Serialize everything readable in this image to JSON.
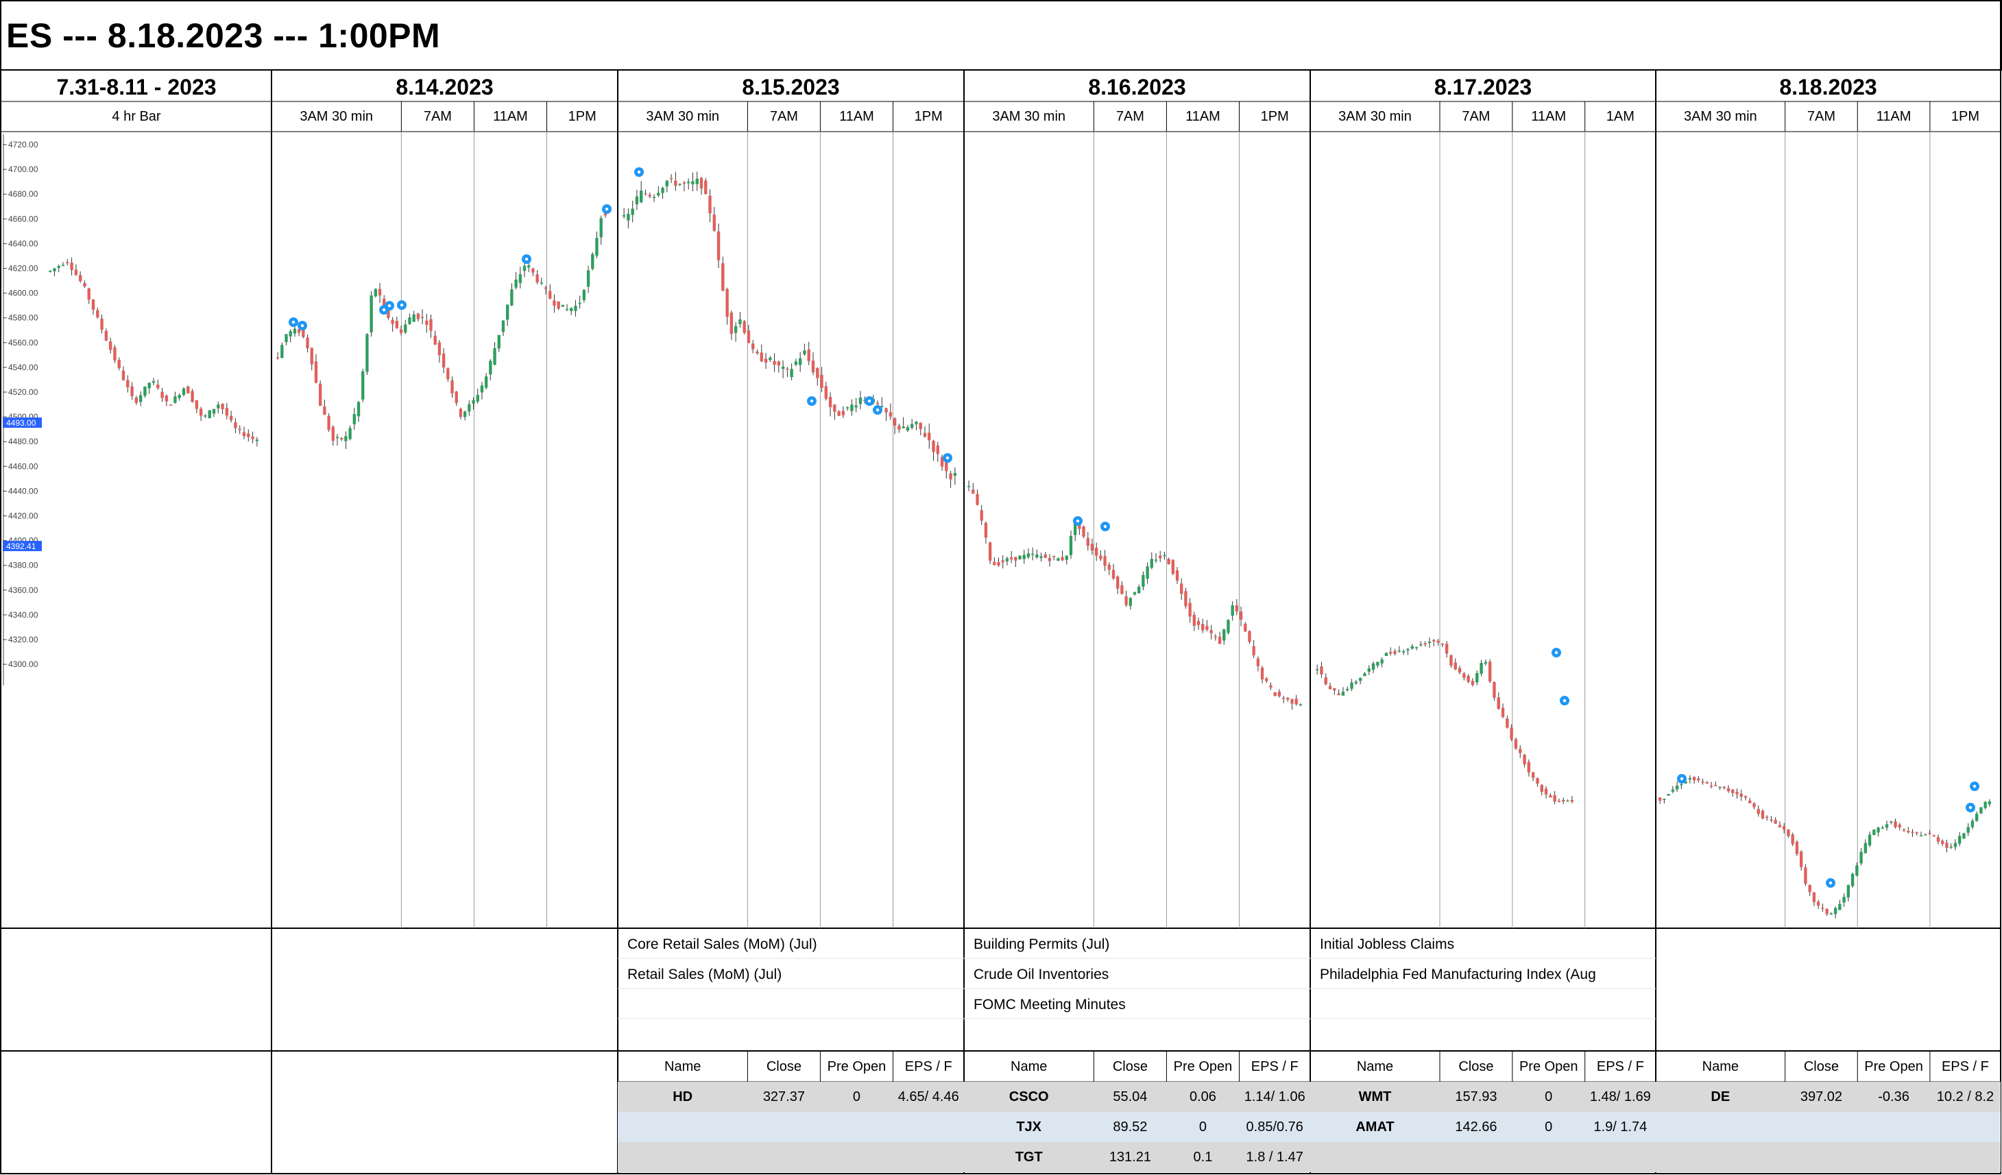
{
  "title": "ES --- 8.18.2023 --- 1:00PM",
  "colors": {
    "up": "#2e9e5e",
    "down": "#e0605c",
    "grid": "#9a9a9a",
    "badge": "#2196f3",
    "row_gray": "#d9d9d9",
    "row_blue": "#dce6f1",
    "price_tag": "#2962ff"
  },
  "days": [
    {
      "label": "7.31-8.11 - 2023",
      "sessions": [
        "4 hr Bar"
      ]
    },
    {
      "label": "8.14.2023",
      "sessions": [
        "3AM 30 min",
        "7AM",
        "11AM",
        "1PM"
      ]
    },
    {
      "label": "8.15.2023",
      "sessions": [
        "3AM 30 min",
        "7AM",
        "11AM",
        "1PM"
      ]
    },
    {
      "label": "8.16.2023",
      "sessions": [
        "3AM 30 min",
        "7AM",
        "11AM",
        "1PM"
      ]
    },
    {
      "label": "8.17.2023",
      "sessions": [
        "3AM 30 min",
        "7AM",
        "11AM",
        "1AM"
      ]
    },
    {
      "label": "8.18.2023",
      "sessions": [
        "3AM 30 min",
        "7AM",
        "11AM",
        "1PM"
      ]
    }
  ],
  "events": [
    {
      "day": 2,
      "items": [
        "Core Retail Sales (MoM) (Jul)",
        "Retail Sales (MoM) (Jul)"
      ]
    },
    {
      "day": 3,
      "items": [
        "Building Permits (Jul)",
        "Crude Oil Inventories",
        "FOMC Meeting Minutes"
      ]
    },
    {
      "day": 4,
      "items": [
        "Initial Jobless Claims",
        "Philadelphia Fed Manufacturing Index (Aug"
      ]
    }
  ],
  "earnings": {
    "headers": [
      "Name",
      "Close",
      "Pre Open",
      "EPS / F"
    ],
    "tables": [
      {
        "day": 2,
        "rows": [
          [
            "HD",
            "327.37",
            "0",
            "4.65/ 4.46"
          ]
        ]
      },
      {
        "day": 3,
        "rows": [
          [
            "CSCO",
            "55.04",
            "0.06",
            "1.14/ 1.06"
          ],
          [
            "TJX",
            "89.52",
            "0",
            "0.85/0.76"
          ],
          [
            "TGT",
            "131.21",
            "0.1",
            "1.8 / 1.47"
          ]
        ]
      },
      {
        "day": 4,
        "rows": [
          [
            "WMT",
            "157.93",
            "0",
            "1.48/ 1.69"
          ],
          [
            "AMAT",
            "142.66",
            "0",
            "1.9/ 1.74"
          ]
        ]
      },
      {
        "day": 5,
        "rows": [
          [
            "DE",
            "397.02",
            "-0.36",
            "10.2 / 8.2"
          ]
        ]
      }
    ]
  },
  "chart_data": {
    "type": "candlestick",
    "symbol": "ES",
    "y_axis": {
      "ticks": [
        4720,
        4700,
        4680,
        4660,
        4640,
        4620,
        4600,
        4580,
        4560,
        4540,
        4520,
        4500,
        4480,
        4460,
        4440,
        4420,
        4400,
        4380,
        4360,
        4340,
        4320,
        4300
      ],
      "tick_labels": [
        "4720.00",
        "4700.00",
        "4680.00",
        "4660.00",
        "4640.00",
        "4620.00",
        "4600.00",
        "4580.00",
        "4560.00",
        "4540.00",
        "4520.00",
        "4500.00",
        "4480.00",
        "4460.00",
        "4440.00",
        "4420.00",
        "4400.00",
        "4380.00",
        "4360.00",
        "4340.00",
        "4320.00",
        "4300.00"
      ],
      "price_tags": [
        "4493.00",
        "4392.41"
      ]
    },
    "panels": [
      {
        "id": "7.31-8.11",
        "y_range": [
          4300,
          4720
        ],
        "paths": [
          [
            0.02,
            4612
          ],
          [
            0.1,
            4620
          ],
          [
            0.18,
            4600
          ],
          [
            0.26,
            4570
          ],
          [
            0.34,
            4540
          ],
          [
            0.42,
            4512
          ],
          [
            0.5,
            4530
          ],
          [
            0.58,
            4510
          ],
          [
            0.66,
            4525
          ],
          [
            0.74,
            4500
          ],
          [
            0.82,
            4512
          ],
          [
            0.9,
            4492
          ],
          [
            0.98,
            4485
          ]
        ]
      },
      {
        "id": "8.14",
        "y_range": [
          4300,
          4720
        ],
        "paths": [
          [
            0.01,
            4540
          ],
          [
            0.04,
            4560
          ],
          [
            0.08,
            4562
          ],
          [
            0.11,
            4545
          ],
          [
            0.14,
            4505
          ],
          [
            0.18,
            4475
          ],
          [
            0.22,
            4478
          ],
          [
            0.26,
            4508
          ],
          [
            0.3,
            4600
          ],
          [
            0.34,
            4575
          ],
          [
            0.38,
            4560
          ],
          [
            0.42,
            4575
          ],
          [
            0.46,
            4570
          ],
          [
            0.52,
            4530
          ],
          [
            0.56,
            4495
          ],
          [
            0.6,
            4505
          ],
          [
            0.64,
            4525
          ],
          [
            0.68,
            4560
          ],
          [
            0.72,
            4595
          ],
          [
            0.76,
            4615
          ],
          [
            0.8,
            4600
          ],
          [
            0.84,
            4585
          ],
          [
            0.88,
            4578
          ],
          [
            0.92,
            4582
          ],
          [
            0.96,
            4618
          ],
          [
            0.99,
            4655
          ]
        ]
      },
      {
        "id": "8.15",
        "y_range": [
          4300,
          4720
        ],
        "paths": [
          [
            0.02,
            4658
          ],
          [
            0.06,
            4680
          ],
          [
            0.1,
            4678
          ],
          [
            0.14,
            4690
          ],
          [
            0.2,
            4686
          ],
          [
            0.24,
            4690
          ],
          [
            0.28,
            4655
          ],
          [
            0.3,
            4610
          ],
          [
            0.33,
            4565
          ],
          [
            0.36,
            4575
          ],
          [
            0.4,
            4545
          ],
          [
            0.45,
            4540
          ],
          [
            0.5,
            4530
          ],
          [
            0.55,
            4548
          ],
          [
            0.6,
            4520
          ],
          [
            0.64,
            4495
          ],
          [
            0.68,
            4500
          ],
          [
            0.72,
            4510
          ],
          [
            0.76,
            4505
          ],
          [
            0.8,
            4495
          ],
          [
            0.84,
            4482
          ],
          [
            0.88,
            4488
          ],
          [
            0.92,
            4476
          ],
          [
            0.95,
            4460
          ],
          [
            0.98,
            4445
          ]
        ]
      },
      {
        "id": "8.16",
        "y_range": [
          4300,
          4720
        ],
        "paths": [
          [
            0.02,
            4445
          ],
          [
            0.05,
            4420
          ],
          [
            0.08,
            4385
          ],
          [
            0.14,
            4390
          ],
          [
            0.2,
            4393
          ],
          [
            0.26,
            4390
          ],
          [
            0.3,
            4390
          ],
          [
            0.33,
            4420
          ],
          [
            0.36,
            4403
          ],
          [
            0.4,
            4392
          ],
          [
            0.44,
            4378
          ],
          [
            0.48,
            4355
          ],
          [
            0.52,
            4370
          ],
          [
            0.56,
            4390
          ],
          [
            0.6,
            4392
          ],
          [
            0.64,
            4368
          ],
          [
            0.68,
            4340
          ],
          [
            0.72,
            4335
          ],
          [
            0.76,
            4325
          ],
          [
            0.8,
            4355
          ],
          [
            0.84,
            4330
          ],
          [
            0.88,
            4300
          ],
          [
            0.92,
            4285
          ],
          [
            0.96,
            4280
          ],
          [
            0.99,
            4278
          ]
        ]
      },
      {
        "id": "8.17",
        "y_range": [
          4300,
          4720
        ],
        "paths": [
          [
            0.02,
            4280
          ],
          [
            0.06,
            4265
          ],
          [
            0.1,
            4262
          ],
          [
            0.16,
            4270
          ],
          [
            0.22,
            4280
          ],
          [
            0.28,
            4290
          ],
          [
            0.34,
            4293
          ],
          [
            0.4,
            4296
          ],
          [
            0.46,
            4300
          ],
          [
            0.5,
            4298
          ],
          [
            0.54,
            4280
          ],
          [
            0.58,
            4275
          ],
          [
            0.62,
            4268
          ],
          [
            0.66,
            4290
          ],
          [
            0.7,
            4258
          ],
          [
            0.74,
            4242
          ],
          [
            0.78,
            4225
          ],
          [
            0.82,
            4212
          ],
          [
            0.86,
            4198
          ],
          [
            0.9,
            4190
          ],
          [
            0.94,
            4186
          ],
          [
            0.98,
            4186
          ]
        ]
      },
      {
        "id": "8.18",
        "y_range": [
          4300,
          4720
        ],
        "paths": [
          [
            0.02,
            4188
          ],
          [
            0.06,
            4195
          ],
          [
            0.1,
            4200
          ],
          [
            0.14,
            4197
          ],
          [
            0.2,
            4194
          ],
          [
            0.26,
            4190
          ],
          [
            0.32,
            4178
          ],
          [
            0.38,
            4172
          ],
          [
            0.42,
            4160
          ],
          [
            0.45,
            4138
          ],
          [
            0.48,
            4128
          ],
          [
            0.52,
            4122
          ],
          [
            0.56,
            4130
          ],
          [
            0.6,
            4150
          ],
          [
            0.64,
            4168
          ],
          [
            0.7,
            4175
          ],
          [
            0.76,
            4168
          ],
          [
            0.82,
            4168
          ],
          [
            0.88,
            4160
          ],
          [
            0.92,
            4168
          ],
          [
            0.96,
            4180
          ],
          [
            0.99,
            4186
          ]
        ]
      }
    ]
  }
}
